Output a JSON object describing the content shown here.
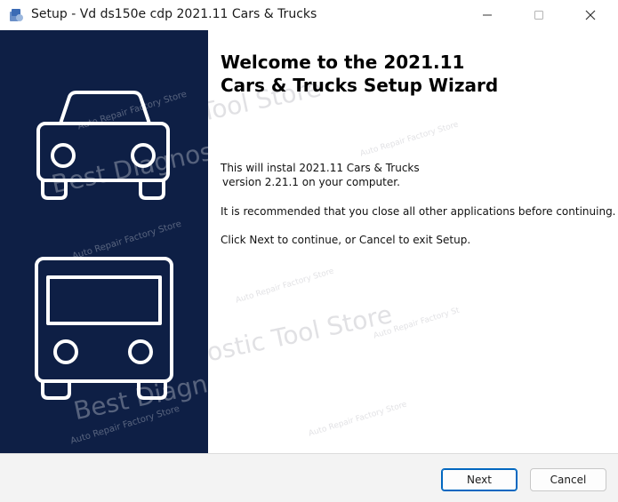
{
  "window": {
    "title": "Setup -  Vd ds150e cdp 2021.11 Cars & Trucks",
    "controls": [
      "minimize-icon",
      "maximize-icon",
      "close-icon"
    ]
  },
  "sidebar": {
    "images": [
      "car-icon",
      "truck-icon"
    ]
  },
  "main": {
    "heading_line1": "Welcome to the 2021.11",
    "heading_line2": "Cars & Trucks Setup Wizard",
    "para1_line1": "This will instal 2021.11 Cars & Trucks",
    "para1_line2": "version 2.21.1 on your computer.",
    "para2": "It is recommended that you close all other applications before continuing.",
    "para3": "Click Next to continue, or Cancel to exit Setup."
  },
  "watermarks": {
    "small": "Auto Repair Factory Store",
    "small_cut": "Auto Repair Factory St",
    "large": "Best Diagnostic Tool Store"
  },
  "footer": {
    "next_label": "Next",
    "cancel_label": "Cancel"
  },
  "colors": {
    "sidebar_bg": "#0e1f45",
    "primary_border": "#0067c0"
  }
}
